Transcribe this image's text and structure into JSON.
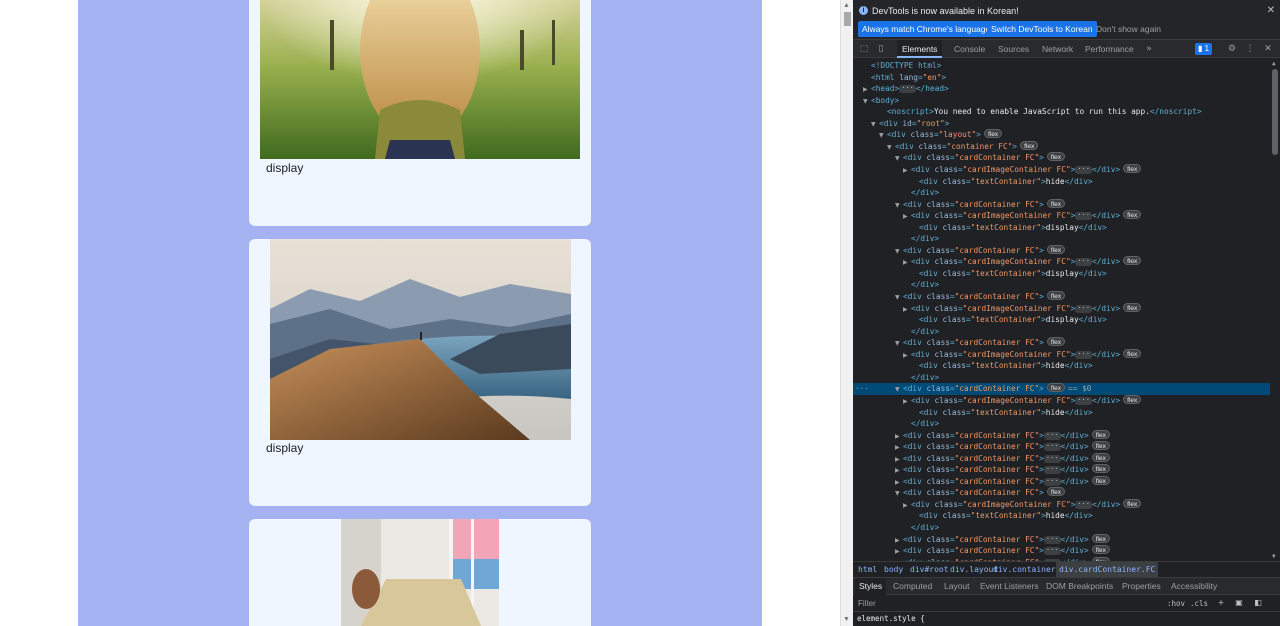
{
  "cards": [
    {
      "text": "display"
    },
    {
      "text": "display"
    },
    {
      "text": ""
    }
  ],
  "devtools": {
    "info_message": "DevTools is now available in Korean!",
    "buttons": {
      "match_language": "Always match Chrome's language",
      "switch_korean": "Switch DevTools to Korean",
      "dont_show": "Don't show again"
    },
    "tabs": [
      "Elements",
      "Console",
      "Sources",
      "Network",
      "Performance"
    ],
    "issues_count": "1",
    "tree": [
      {
        "indent": 0,
        "tri": "",
        "html": "&lt;!DOCTYPE html&gt;",
        "raw": true
      },
      {
        "indent": 0,
        "tri": "",
        "tag": "html",
        "attrs": [
          [
            "lang",
            "en"
          ]
        ],
        "close": false
      },
      {
        "indent": 0,
        "tri": "right",
        "tag": "head",
        "collapsed": true
      },
      {
        "indent": 0,
        "tri": "down",
        "tag": "body",
        "attrs": [],
        "close": false
      },
      {
        "indent": 2,
        "tri": "",
        "tag": "noscript",
        "inner": "You need to enable JavaScript to run this app."
      },
      {
        "indent": 1,
        "tri": "down",
        "tag": "div",
        "attrs": [
          [
            "id",
            "root"
          ]
        ]
      },
      {
        "indent": 2,
        "tri": "down",
        "tag": "div",
        "attrs": [
          [
            "class",
            "layout"
          ]
        ],
        "flex": true
      },
      {
        "indent": 3,
        "tri": "down",
        "tag": "div",
        "attrs": [
          [
            "class",
            "container FC"
          ]
        ],
        "flex": true
      },
      {
        "indent": 4,
        "tri": "down",
        "tag": "div",
        "attrs": [
          [
            "class",
            "cardContainer FC"
          ]
        ],
        "flex": true
      },
      {
        "indent": 5,
        "tri": "right",
        "tag": "div",
        "attrs": [
          [
            "class",
            "cardImageContainer FC"
          ]
        ],
        "collapsed": true,
        "flex": true
      },
      {
        "indent": 6,
        "tri": "",
        "tag": "div",
        "attrs": [
          [
            "class",
            "textContainer"
          ]
        ],
        "inner": "hide"
      },
      {
        "indent": 5,
        "tri": "",
        "closing": "div"
      },
      {
        "indent": 4,
        "tri": "down",
        "tag": "div",
        "attrs": [
          [
            "class",
            "cardContainer FC"
          ]
        ],
        "flex": true
      },
      {
        "indent": 5,
        "tri": "right",
        "tag": "div",
        "attrs": [
          [
            "class",
            "cardImageContainer FC"
          ]
        ],
        "collapsed": true,
        "flex": true
      },
      {
        "indent": 6,
        "tri": "",
        "tag": "div",
        "attrs": [
          [
            "class",
            "textContainer"
          ]
        ],
        "inner": "display"
      },
      {
        "indent": 5,
        "tri": "",
        "closing": "div"
      },
      {
        "indent": 4,
        "tri": "down",
        "tag": "div",
        "attrs": [
          [
            "class",
            "cardContainer FC"
          ]
        ],
        "flex": true
      },
      {
        "indent": 5,
        "tri": "right",
        "tag": "div",
        "attrs": [
          [
            "class",
            "cardImageContainer FC"
          ]
        ],
        "collapsed": true,
        "flex": true
      },
      {
        "indent": 6,
        "tri": "",
        "tag": "div",
        "attrs": [
          [
            "class",
            "textContainer"
          ]
        ],
        "inner": "display"
      },
      {
        "indent": 5,
        "tri": "",
        "closing": "div"
      },
      {
        "indent": 4,
        "tri": "down",
        "tag": "div",
        "attrs": [
          [
            "class",
            "cardContainer FC"
          ]
        ],
        "flex": true
      },
      {
        "indent": 5,
        "tri": "right",
        "tag": "div",
        "attrs": [
          [
            "class",
            "cardImageContainer FC"
          ]
        ],
        "collapsed": true,
        "flex": true
      },
      {
        "indent": 6,
        "tri": "",
        "tag": "div",
        "attrs": [
          [
            "class",
            "textContainer"
          ]
        ],
        "inner": "display"
      },
      {
        "indent": 5,
        "tri": "",
        "closing": "div"
      },
      {
        "indent": 4,
        "tri": "down",
        "tag": "div",
        "attrs": [
          [
            "class",
            "cardContainer FC"
          ]
        ],
        "flex": true
      },
      {
        "indent": 5,
        "tri": "right",
        "tag": "div",
        "attrs": [
          [
            "class",
            "cardImageContainer FC"
          ]
        ],
        "collapsed": true,
        "flex": true
      },
      {
        "indent": 6,
        "tri": "",
        "tag": "div",
        "attrs": [
          [
            "class",
            "textContainer"
          ]
        ],
        "inner": "hide"
      },
      {
        "indent": 5,
        "tri": "",
        "closing": "div"
      },
      {
        "indent": 4,
        "tri": "down",
        "tag": "div",
        "attrs": [
          [
            "class",
            "cardContainer FC"
          ]
        ],
        "flex": true,
        "selected": true,
        "dollar": "== $0"
      },
      {
        "indent": 5,
        "tri": "right",
        "tag": "div",
        "attrs": [
          [
            "class",
            "cardImageContainer FC"
          ]
        ],
        "collapsed": true,
        "flex": true
      },
      {
        "indent": 6,
        "tri": "",
        "tag": "div",
        "attrs": [
          [
            "class",
            "textContainer"
          ]
        ],
        "inner": "hide"
      },
      {
        "indent": 5,
        "tri": "",
        "closing": "div"
      },
      {
        "indent": 4,
        "tri": "right",
        "tag": "div",
        "attrs": [
          [
            "class",
            "cardContainer FC"
          ]
        ],
        "collapsed": true,
        "flex": true
      },
      {
        "indent": 4,
        "tri": "right",
        "tag": "div",
        "attrs": [
          [
            "class",
            "cardContainer FC"
          ]
        ],
        "collapsed": true,
        "flex": true
      },
      {
        "indent": 4,
        "tri": "right",
        "tag": "div",
        "attrs": [
          [
            "class",
            "cardContainer FC"
          ]
        ],
        "collapsed": true,
        "flex": true
      },
      {
        "indent": 4,
        "tri": "right",
        "tag": "div",
        "attrs": [
          [
            "class",
            "cardContainer FC"
          ]
        ],
        "collapsed": true,
        "flex": true
      },
      {
        "indent": 4,
        "tri": "right",
        "tag": "div",
        "attrs": [
          [
            "class",
            "cardContainer FC"
          ]
        ],
        "collapsed": true,
        "flex": true
      },
      {
        "indent": 4,
        "tri": "down",
        "tag": "div",
        "attrs": [
          [
            "class",
            "cardContainer FC"
          ]
        ],
        "flex": true
      },
      {
        "indent": 5,
        "tri": "right",
        "tag": "div",
        "attrs": [
          [
            "class",
            "cardImageContainer FC"
          ]
        ],
        "collapsed": true,
        "flex": true
      },
      {
        "indent": 6,
        "tri": "",
        "tag": "div",
        "attrs": [
          [
            "class",
            "textContainer"
          ]
        ],
        "inner": "hide"
      },
      {
        "indent": 5,
        "tri": "",
        "closing": "div"
      },
      {
        "indent": 4,
        "tri": "right",
        "tag": "div",
        "attrs": [
          [
            "class",
            "cardContainer FC"
          ]
        ],
        "collapsed": true,
        "flex": true
      },
      {
        "indent": 4,
        "tri": "right",
        "tag": "div",
        "attrs": [
          [
            "class",
            "cardContainer FC"
          ]
        ],
        "collapsed": true,
        "flex": true
      },
      {
        "indent": 4,
        "tri": "right",
        "tag": "div",
        "attrs": [
          [
            "class",
            "cardContainer FC"
          ]
        ],
        "collapsed": true,
        "flex": true
      }
    ],
    "breadcrumbs": [
      "html",
      "body",
      "div#root",
      "div.layout",
      "div.container.FC",
      "div.cardContainer.FC"
    ],
    "style_tabs": [
      "Styles",
      "Computed",
      "Layout",
      "Event Listeners",
      "DOM Breakpoints",
      "Properties",
      "Accessibility"
    ],
    "filter_placeholder": "Filter",
    "hov_label": ":hov",
    "cls_label": ".cls",
    "element_style": "element.style {"
  }
}
